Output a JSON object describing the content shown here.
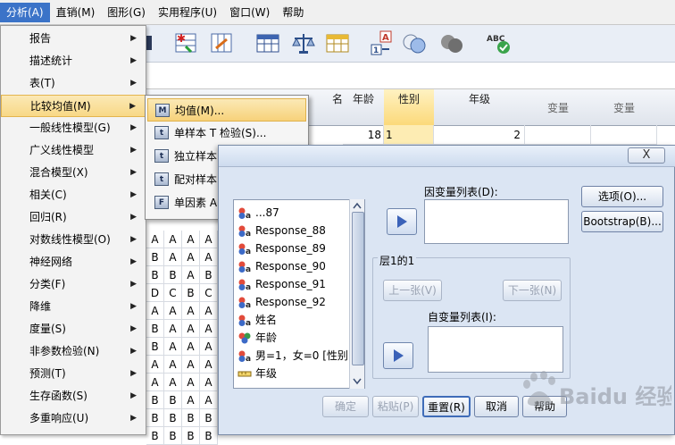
{
  "menubar": [
    {
      "label": "分析(A)",
      "active": true
    },
    {
      "label": "直销(M)",
      "active": false
    },
    {
      "label": "图形(G)",
      "active": false
    },
    {
      "label": "实用程序(U)",
      "active": false
    },
    {
      "label": "窗口(W)",
      "active": false
    },
    {
      "label": "帮助",
      "active": false
    }
  ],
  "menu": {
    "items": [
      {
        "label": "报告",
        "has_sub": true
      },
      {
        "label": "描述统计",
        "has_sub": true
      },
      {
        "label": "表(T)",
        "has_sub": true
      },
      {
        "label": "比较均值(M)",
        "has_sub": true,
        "active": true
      },
      {
        "label": "一般线性模型(G)",
        "has_sub": true
      },
      {
        "label": "广义线性模型",
        "has_sub": true
      },
      {
        "label": "混合模型(X)",
        "has_sub": true
      },
      {
        "label": "相关(C)",
        "has_sub": true
      },
      {
        "label": "回归(R)",
        "has_sub": true
      },
      {
        "label": "对数线性模型(O)",
        "has_sub": true
      },
      {
        "label": "神经网络",
        "has_sub": true
      },
      {
        "label": "分类(F)",
        "has_sub": true
      },
      {
        "label": "降维",
        "has_sub": true
      },
      {
        "label": "度量(S)",
        "has_sub": true
      },
      {
        "label": "非参数检验(N)",
        "has_sub": true
      },
      {
        "label": "预测(T)",
        "has_sub": true
      },
      {
        "label": "生存函数(S)",
        "has_sub": true
      },
      {
        "label": "多重响应(U)",
        "has_sub": true
      }
    ]
  },
  "submenu": {
    "items": [
      {
        "icon": "M",
        "label": "均值(M)...",
        "active": true
      },
      {
        "icon": "t",
        "label": "单样本 T 检验(S)..."
      },
      {
        "icon": "t",
        "label": "独立样本 T 检验(T)..."
      },
      {
        "icon": "t",
        "label": "配对样本 T 检验(P)..."
      },
      {
        "icon": "F",
        "label": "单因素 ANOVA..."
      }
    ]
  },
  "grid": {
    "headers": [
      {
        "label": "名",
        "selected": false
      },
      {
        "label": "年龄",
        "selected": false
      },
      {
        "label": "性别",
        "selected": true
      },
      {
        "label": "年级",
        "selected": false
      },
      {
        "label": "变量",
        "selected": false
      },
      {
        "label": "变量",
        "selected": false
      }
    ],
    "row1": {
      "age": "18",
      "gender": "1",
      "grade": "2"
    },
    "left_cells": [
      [
        "A",
        "A",
        "A",
        "A"
      ],
      [
        "B",
        "A",
        "A",
        "A"
      ],
      [
        "B",
        "B",
        "A",
        "B"
      ],
      [
        "D",
        "C",
        "B",
        "C"
      ],
      [
        "A",
        "A",
        "A",
        "A"
      ],
      [
        "B",
        "A",
        "A",
        "A"
      ],
      [
        "B",
        "A",
        "A",
        "A"
      ],
      [
        "A",
        "A",
        "A",
        "A"
      ],
      [
        "A",
        "A",
        "A",
        "A"
      ],
      [
        "B",
        "B",
        "A",
        "A"
      ],
      [
        "B",
        "B",
        "B",
        "B"
      ],
      [
        "B",
        "B",
        "B",
        "B"
      ]
    ]
  },
  "dialog": {
    "close_label": "X",
    "variables": [
      {
        "label": "...87",
        "type": "nominal"
      },
      {
        "label": "Response_88",
        "type": "nominal"
      },
      {
        "label": "Response_89",
        "type": "nominal"
      },
      {
        "label": "Response_90",
        "type": "nominal"
      },
      {
        "label": "Response_91",
        "type": "nominal"
      },
      {
        "label": "Response_92",
        "type": "nominal"
      },
      {
        "label": "姓名",
        "type": "nominal"
      },
      {
        "label": "年龄",
        "type": "ordinal"
      },
      {
        "label": "男=1，女=0 [性别]",
        "type": "nominal"
      },
      {
        "label": "年级",
        "type": "scale"
      }
    ],
    "dependent_label": "因变量列表(D):",
    "layer_label": "层1的1",
    "prev_label": "上一张(V)",
    "next_label": "下一张(N)",
    "independent_label": "自变量列表(I):",
    "options_label": "选项(O)...",
    "bootstrap_label": "Bootstrap(B)...",
    "ok_label": "确定",
    "paste_label": "粘贴(P)",
    "reset_label": "重置(R)",
    "cancel_label": "取消",
    "help_label": "帮助"
  },
  "watermark": {
    "text": "Baidu 经验"
  },
  "colors": {
    "menu_highlight": "#f8d886",
    "selection_blue": "#3b73c8",
    "dialog_bg": "#dbe5f3"
  }
}
